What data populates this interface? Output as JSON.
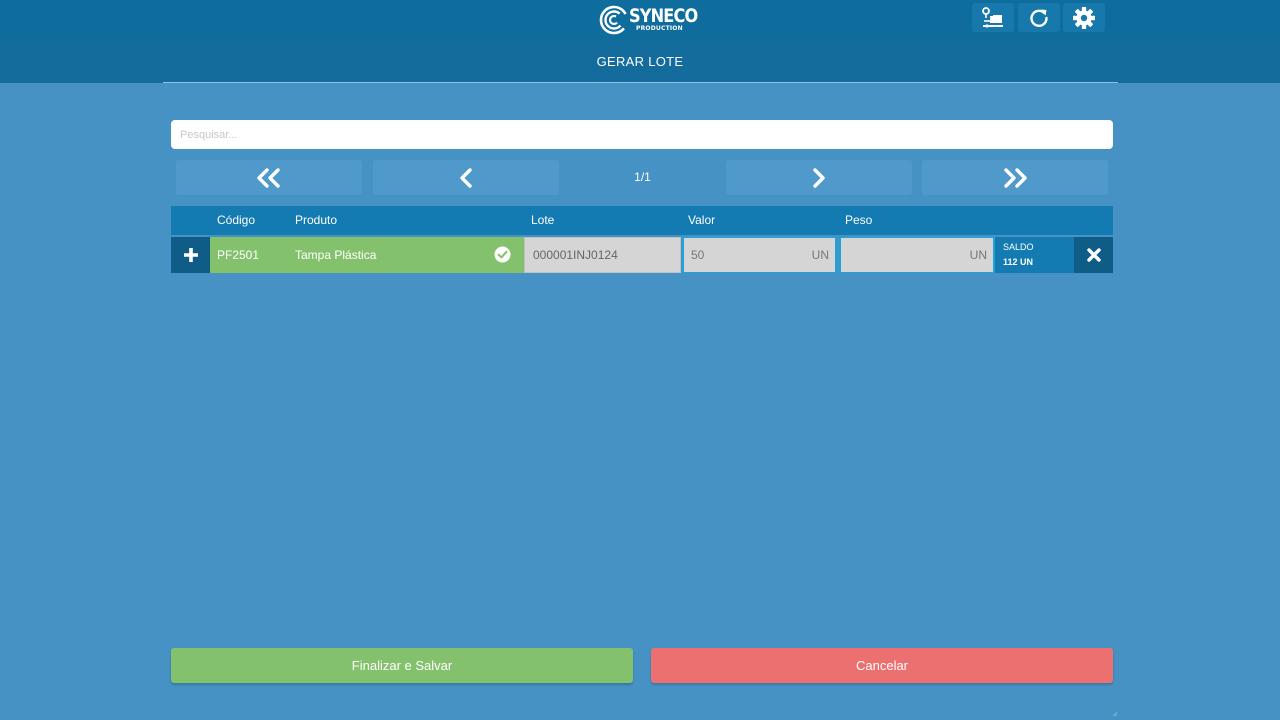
{
  "header": {
    "logo_text": "SYNECO",
    "logo_subtext": "PRODUCTION",
    "icons": [
      "delivery-icon",
      "refresh-icon",
      "settings-icon"
    ]
  },
  "page": {
    "title": "GERAR LOTE"
  },
  "search": {
    "placeholder": "Pesquisar...",
    "value": ""
  },
  "pagination": {
    "info": "1/1",
    "icons": [
      "double-chevron-left-icon",
      "chevron-left-icon",
      "chevron-right-icon",
      "double-chevron-right-icon"
    ]
  },
  "table": {
    "columns": {
      "codigo": "Código",
      "produto": "Produto",
      "lote": "Lote",
      "valor": "Valor",
      "peso": "Peso"
    },
    "rows": [
      {
        "codigo": "PF2501",
        "produto": "Tampa Plástica",
        "lote": "000001INJ0124",
        "valor": "50",
        "valor_unit": "UN",
        "peso": "",
        "peso_unit": "UN",
        "saldo_label": "SALDO",
        "saldo_value": "112 UN",
        "selected": true
      }
    ]
  },
  "actions": {
    "save_label": "Finalizar e Salvar",
    "cancel_label": "Cancelar"
  },
  "colors": {
    "background": "#4692c4",
    "topbar": "#0f6d9d",
    "header_row": "#137bb1",
    "success": "#84c16d",
    "danger": "#ec7070",
    "field": "#d5d5d5"
  }
}
